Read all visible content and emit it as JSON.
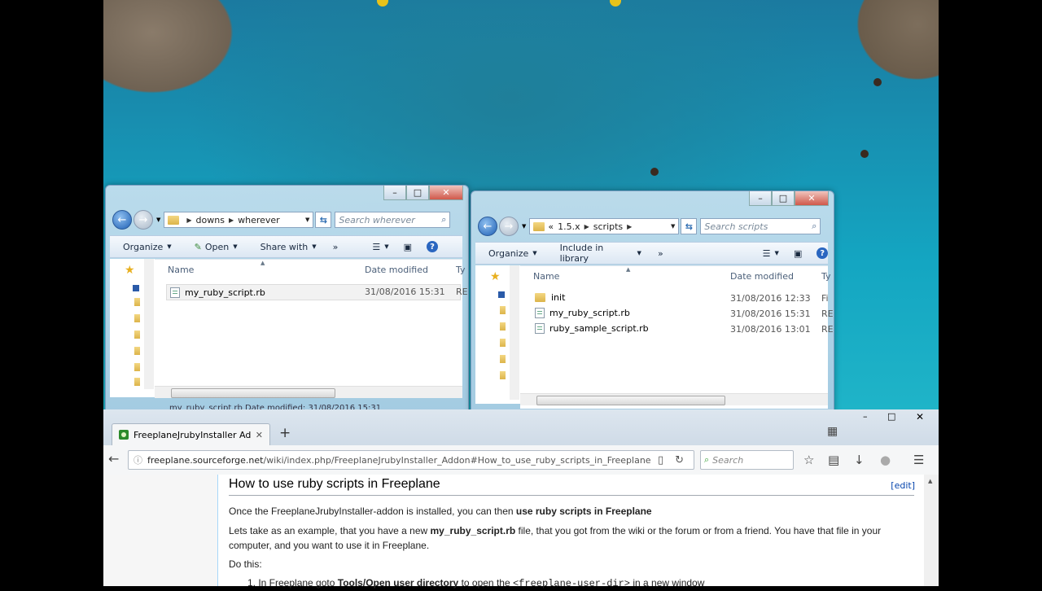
{
  "left_explorer": {
    "breadcrumb": [
      "downs",
      "wherever"
    ],
    "search_placeholder": "Search wherever",
    "toolbar": {
      "organize": "Organize",
      "open": "Open",
      "share_with": "Share with",
      "more": "»"
    },
    "columns": {
      "name": "Name",
      "date_modified": "Date modified",
      "type": "Ty"
    },
    "files": [
      {
        "name": "my_ruby_script.rb",
        "date": "31/08/2016 15:31",
        "type": "RE"
      }
    ],
    "details_partial": "my_ruby_script.rb   Date modified: 31/08/2016 15:31"
  },
  "right_explorer": {
    "breadcrumb": [
      "«",
      "1.5.x",
      "scripts"
    ],
    "search_placeholder": "Search scripts",
    "toolbar": {
      "organize": "Organize",
      "include_in_library": "Include in library",
      "more": "»"
    },
    "columns": {
      "name": "Name",
      "date_modified": "Date modified",
      "type": "Ty"
    },
    "files": [
      {
        "name": "init",
        "date": "31/08/2016 12:33",
        "type": "Fi",
        "kind": "folder"
      },
      {
        "name": "my_ruby_script.rb",
        "date": "31/08/2016 15:31",
        "type": "RE",
        "kind": "file"
      },
      {
        "name": "ruby_sample_script.rb",
        "date": "31/08/2016 13:01",
        "type": "RE",
        "kind": "file"
      }
    ]
  },
  "browser": {
    "tab_title": "FreeplaneJrubyInstaller Ad",
    "new_tab": "+",
    "url_domain": "freeplane.sourceforge.net",
    "url_path": "/wiki/index.php/FreeplaneJrubyInstaller_Addon#How_to_use_ruby_scripts_in_Freeplane",
    "search_placeholder": "Search",
    "heading": "How to use ruby scripts in Freeplane",
    "edit_link": "[edit]",
    "para1_text": "Once the FreeplaneJrubyInstaller-addon is installed, you can then ",
    "para1_bold": "use ruby scripts in Freeplane",
    "para2_a": "Lets take as an example, that you have a new ",
    "para2_bold": "my_ruby_script.rb",
    "para2_b": " file, that you got from the wiki or the forum or from a friend. You have that file in your",
    "para2_c": "computer, and you want to use it in Freeplane.",
    "para3": "Do this:",
    "step1_a": "1. In Freeplane goto ",
    "step1_bold": "Tools/Open user directory",
    "step1_b": " to open the ",
    "step1_code": "<freeplane-user-dir>",
    "step1_c": " in a new window"
  },
  "colors": {
    "water": "#1fa8c4",
    "link": "#0645ad",
    "explorer_frame": "#b9d1ea"
  }
}
